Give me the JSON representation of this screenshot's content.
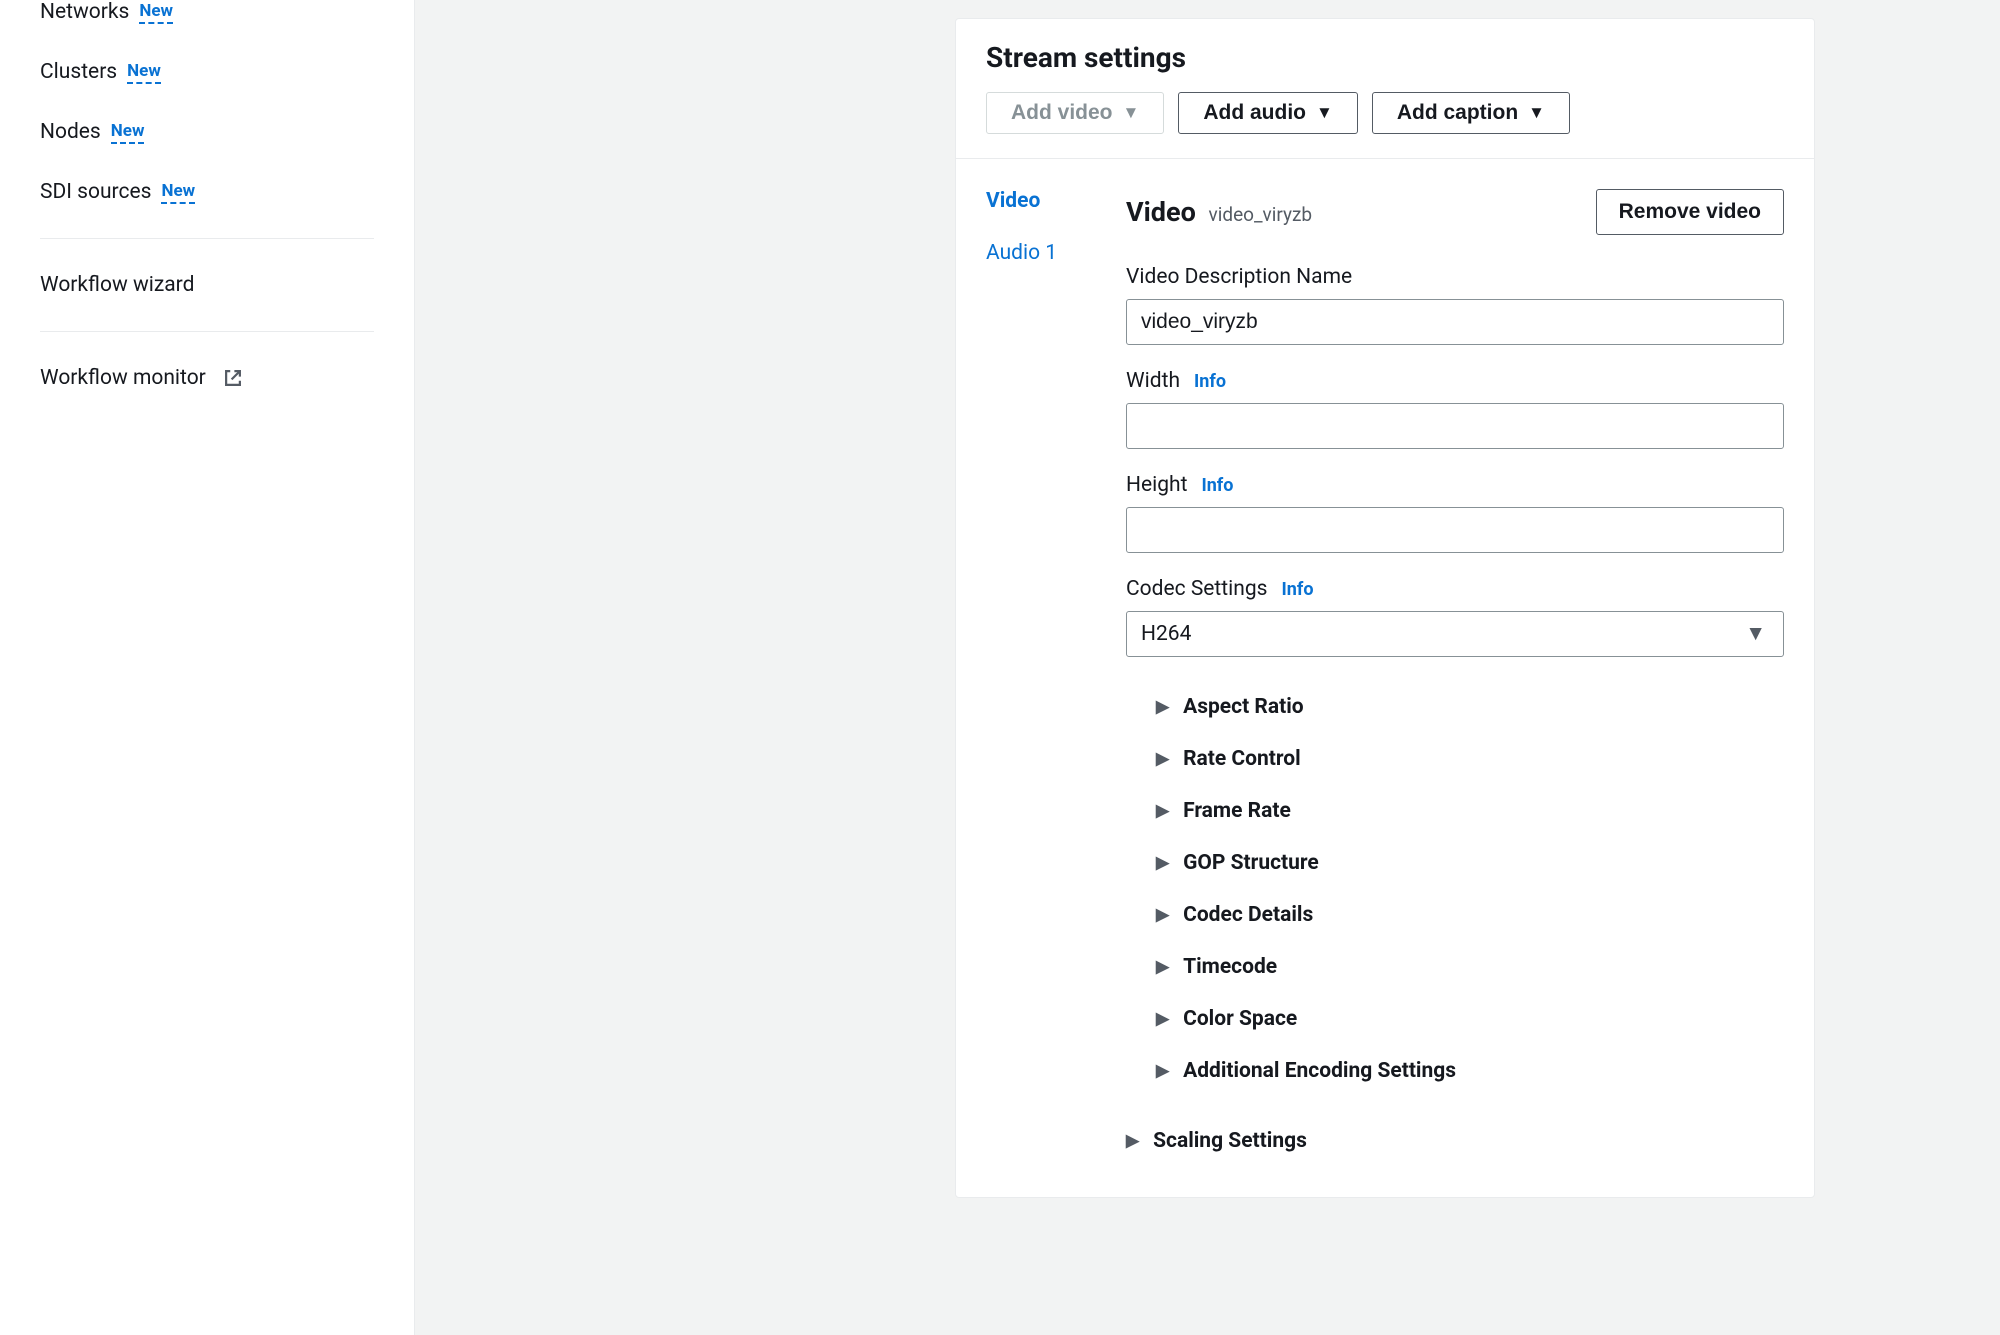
{
  "sidebar": {
    "items": [
      {
        "label": "Networks",
        "badge": "New"
      },
      {
        "label": "Clusters",
        "badge": "New"
      },
      {
        "label": "Nodes",
        "badge": "New"
      },
      {
        "label": "SDI sources",
        "badge": "New"
      }
    ],
    "wizard": "Workflow wizard",
    "monitor": "Workflow monitor"
  },
  "panel": {
    "title": "Stream settings",
    "buttons": {
      "addVideo": "Add video",
      "addAudio": "Add audio",
      "addCaption": "Add caption"
    },
    "tabs": {
      "video": "Video",
      "audio": "Audio 1"
    },
    "form": {
      "heading": "Video",
      "headingSub": "video_viryzb",
      "removeBtn": "Remove video",
      "fields": {
        "nameLabel": "Video Description Name",
        "nameValue": "video_viryzb",
        "widthLabel": "Width",
        "widthValue": "",
        "heightLabel": "Height",
        "heightValue": "",
        "codecLabel": "Codec Settings",
        "codecValue": "H264",
        "infoText": "Info"
      },
      "expanders": [
        "Aspect Ratio",
        "Rate Control",
        "Frame Rate",
        "GOP Structure",
        "Codec Details",
        "Timecode",
        "Color Space",
        "Additional Encoding Settings"
      ],
      "outerExpander": "Scaling Settings"
    }
  }
}
